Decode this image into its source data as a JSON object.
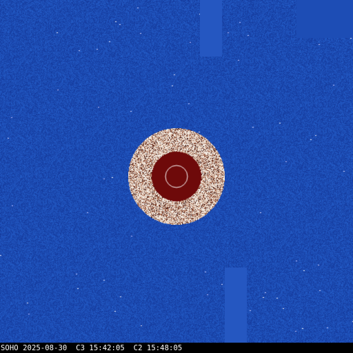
{
  "image": {
    "observatory_label": "SOHO",
    "date": "2025-08-30",
    "c3_time": "C3 15:42:05",
    "c2_time": "C2 15:48:05",
    "colors": {
      "background_blue": "#1c4bb2",
      "occulter_red": "#6e0a0a",
      "corona_white": "#f4ece4",
      "sun_outline": "#ffffff"
    }
  }
}
